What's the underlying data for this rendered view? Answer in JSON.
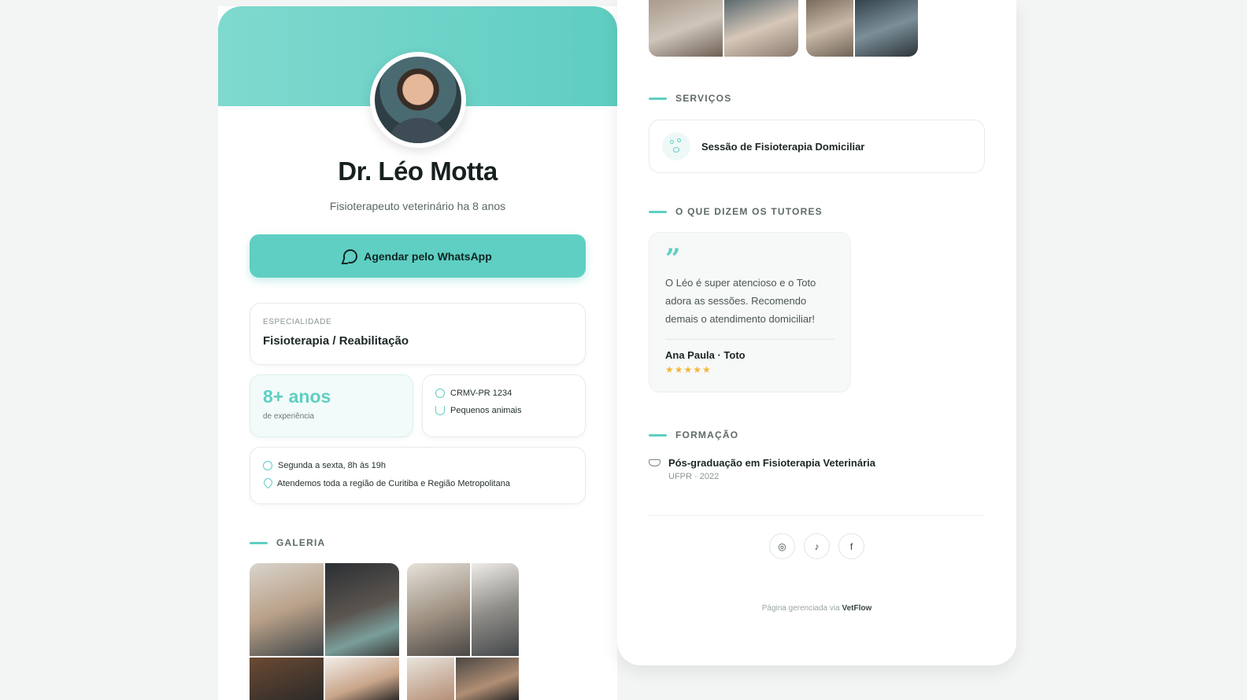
{
  "profile": {
    "name": "Dr. Léo Motta",
    "subtitle": "Fisioterapeuto veterinário ha 8 anos",
    "whatsapp_label": "Agendar pelo WhatsApp"
  },
  "specialty": {
    "label": "ESPECIALIDADE",
    "value": "Fisioterapia / Reabilitação"
  },
  "experience": {
    "value": "8+ anos",
    "label": "de experiência"
  },
  "credentials": {
    "crmv": "CRMV-PR 1234",
    "patients": "Pequenos animais"
  },
  "availability": {
    "hours": "Segunda a sexta, 8h às 19h",
    "region": "Atendemos toda a região de Curitiba e Região Metropolitana"
  },
  "sections": {
    "gallery": "GALERIA",
    "services": "SERVIÇOS",
    "testimonials": "O QUE DIZEM OS TUTORES",
    "education": "FORMAÇÃO"
  },
  "services": [
    {
      "label": "Sessão de Fisioterapia Domiciliar"
    }
  ],
  "testimonial": {
    "quote": "O Léo é super atencioso e o Toto adora as sessões. Recomendo demais o atendimento domiciliar!",
    "author": "Ana Paula · Toto",
    "stars": "★★★★★",
    "rating": 5
  },
  "education": {
    "title": "Pós-graduação em Fisioterapia Veterinária",
    "detail": "UFPR · 2022"
  },
  "social": [
    {
      "icon": "instagram-icon",
      "glyph": "◎"
    },
    {
      "icon": "tiktok-icon",
      "glyph": "♪"
    },
    {
      "icon": "facebook-icon",
      "glyph": "f"
    }
  ],
  "footer": {
    "prefix": "Página gerenciada via ",
    "brand": "VetFlow"
  },
  "colors": {
    "accent": "#5fcfc3",
    "background": "#f3f5f4",
    "star": "#f4b73b"
  }
}
